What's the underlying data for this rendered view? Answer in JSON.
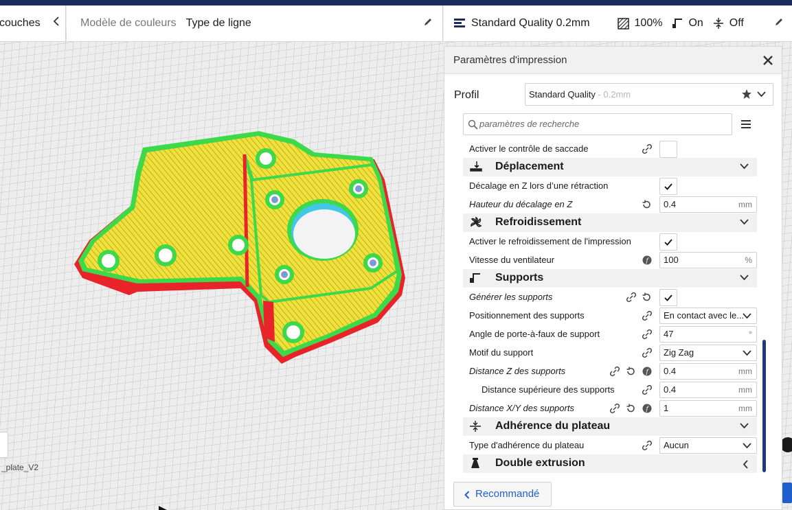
{
  "header": {
    "left_label": "couches",
    "color_scheme_label": "Modèle de couleurs",
    "color_scheme_value": "Type de ligne",
    "profile_short": "Standard Quality 0.2mm",
    "infill": "100%",
    "support": "On",
    "adhesion": "Off"
  },
  "viewport": {
    "filename": "_plate_V2"
  },
  "panel": {
    "title": "Paramètres d'impression",
    "profile_label": "Profil",
    "profile_name": "Standard Quality",
    "profile_sub": " - 0.2mm",
    "search_placeholder": "paramètres de recherche",
    "recommend_button": "Recommandé"
  },
  "settings": {
    "jerk": "Activer le contrôle de saccade",
    "cat_travel": "Déplacement",
    "zhop": "Décalage en Z lors d’une rétraction",
    "zhop_height": "Hauteur du décalage en Z",
    "zhop_height_value": "0.4",
    "zhop_height_unit": "mm",
    "cat_cooling": "Refroidissement",
    "cooling_enable": "Activer le refroidissement de l'impression",
    "fan_speed": "Vitesse du ventilateur",
    "fan_speed_value": "100",
    "fan_speed_unit": "%",
    "cat_support": "Supports",
    "support_gen": "Générer les supports",
    "support_placement": "Positionnement des supports",
    "support_placement_value": "En contact avec le...",
    "support_angle": "Angle de porte-à-faux de support",
    "support_angle_value": "47",
    "support_angle_unit": "°",
    "support_pattern": "Motif du support",
    "support_pattern_value": "Zig Zag",
    "support_z": "Distance Z des supports",
    "support_z_value": "0.4",
    "support_z_unit": "mm",
    "support_top": "Distance supérieure des supports",
    "support_top_value": "0.4",
    "support_top_unit": "mm",
    "support_xy": "Distance X/Y des supports",
    "support_xy_value": "1",
    "support_xy_unit": "mm",
    "cat_adhesion": "Adhérence du plateau",
    "adhesion_type": "Type d'adhérence du plateau",
    "adhesion_type_value": "Aucun",
    "cat_dual": "Double extrusion"
  },
  "colors": {
    "accent": "#1f5fcc",
    "navy": "#1b2b5a",
    "model_yellow": "#f0e03a",
    "model_green": "#3ed94a",
    "model_red": "#e8242a",
    "model_cyan": "#43c7e6"
  }
}
